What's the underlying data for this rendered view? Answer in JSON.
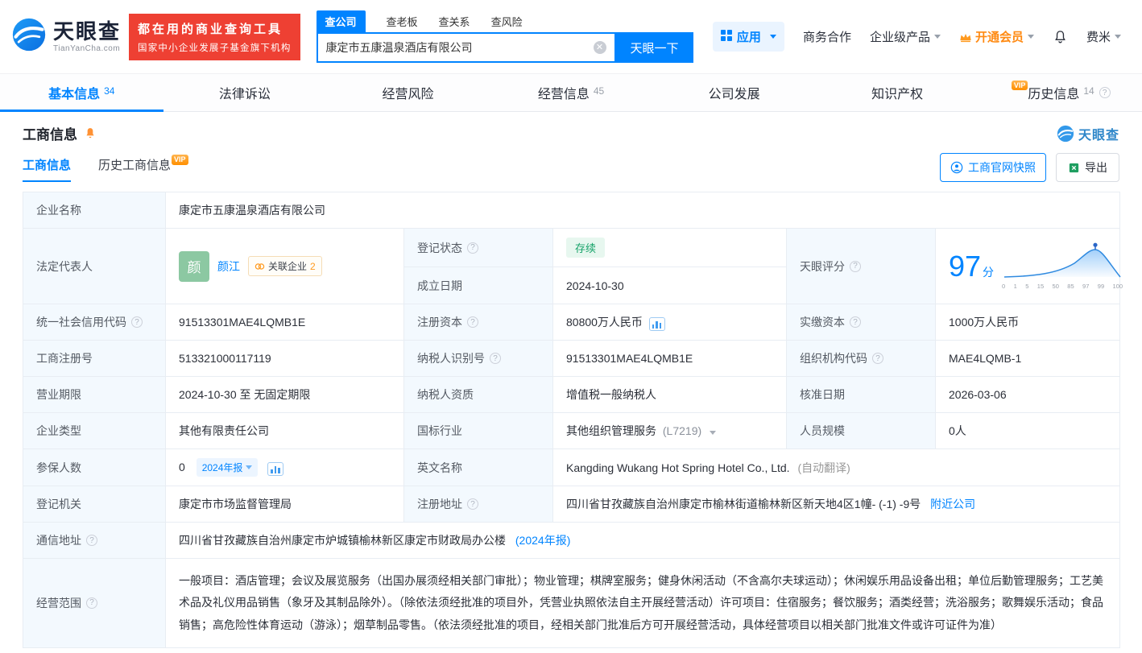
{
  "vip_tag": "VIP",
  "brand": {
    "logo_text": "天眼查",
    "logo_domain": "TianYanCha.com",
    "banner_line1": "都在用的商业查询工具",
    "banner_line2": "国家中小企业发展子基金旗下机构"
  },
  "search": {
    "tab_company": "查公司",
    "tab_boss": "查老板",
    "tab_relation": "查关系",
    "tab_risk": "查风险",
    "value": "康定市五康温泉酒店有限公司",
    "button": "天眼一下"
  },
  "topnav": {
    "app": "应用",
    "cooperation": "商务合作",
    "enterprise": "企业级产品",
    "vip": "开通会员",
    "user": "费米"
  },
  "nav_tabs": {
    "t0": {
      "label": "基本信息",
      "count": "34"
    },
    "t1": {
      "label": "法律诉讼"
    },
    "t2": {
      "label": "经营风险"
    },
    "t3": {
      "label": "经营信息",
      "count": "45"
    },
    "t4": {
      "label": "公司发展"
    },
    "t5": {
      "label": "知识产权"
    },
    "t6": {
      "label": "历史信息",
      "count": "14"
    }
  },
  "section": {
    "title": "工商信息",
    "subtab_current": "工商信息",
    "subtab_history": "历史工商信息",
    "snapshot_button": "工商官网快照",
    "export_button": "导出",
    "watermark": "天眼查"
  },
  "fields": {
    "company_name": {
      "label": "企业名称",
      "value": "康定市五康温泉酒店有限公司"
    },
    "legal_rep": {
      "label": "法定代表人",
      "avatar": "颜",
      "name": "颜江",
      "related_label": "关联企业",
      "related_count": "2"
    },
    "reg_status": {
      "label": "登记状态",
      "value": "存续"
    },
    "establish_date": {
      "label": "成立日期",
      "value": "2024-10-30"
    },
    "score": {
      "label": "天眼评分",
      "value": "97",
      "unit": "分",
      "ticks": [
        "0",
        "1",
        "5",
        "15",
        "50",
        "85",
        "97",
        "99",
        "100"
      ]
    },
    "credit_code": {
      "label": "统一社会信用代码",
      "value": "91513301MAE4LQMB1E"
    },
    "reg_capital": {
      "label": "注册资本",
      "value": "80800万人民币"
    },
    "paid_capital": {
      "label": "实缴资本",
      "value": "1000万人民币"
    },
    "reg_number": {
      "label": "工商注册号",
      "value": "513321000117119"
    },
    "taxpayer_id": {
      "label": "纳税人识别号",
      "value": "91513301MAE4LQMB1E"
    },
    "org_code": {
      "label": "组织机构代码",
      "value": "MAE4LQMB-1"
    },
    "business_term": {
      "label": "营业期限",
      "value": "2024-10-30 至 无固定期限"
    },
    "taxpayer_quality": {
      "label": "纳税人资质",
      "value": "增值税一般纳税人"
    },
    "approval_date": {
      "label": "核准日期",
      "value": "2026-03-06"
    },
    "company_type": {
      "label": "企业类型",
      "value": "其他有限责任公司"
    },
    "industry": {
      "label": "国标行业",
      "value": "其他组织管理服务",
      "code": "(L7219)"
    },
    "staff_size": {
      "label": "人员规模",
      "value": "0人"
    },
    "insured_count": {
      "label": "参保人数",
      "value": "0",
      "badge": "2024年报"
    },
    "english_name": {
      "label": "英文名称",
      "value": "Kangding Wukang Hot Spring Hotel Co., Ltd.",
      "note": "(自动翻译)"
    },
    "reg_authority": {
      "label": "登记机关",
      "value": "康定市市场监督管理局"
    },
    "reg_address": {
      "label": "注册地址",
      "value": "四川省甘孜藏族自治州康定市榆林街道榆林新区新天地4区1幢- (-1) -9号",
      "link": "附近公司"
    },
    "mail_address": {
      "label": "通信地址",
      "value": "四川省甘孜藏族自治州康定市炉城镇榆林新区康定市财政局办公楼",
      "link": "(2024年报)"
    },
    "business_scope": {
      "label": "经营范围",
      "value": "一般项目：酒店管理；会议及展览服务（出国办展须经相关部门审批）；物业管理；棋牌室服务；健身休闲活动（不含高尔夫球运动）；休闲娱乐用品设备出租；单位后勤管理服务；工艺美术品及礼仪用品销售（象牙及其制品除外）。（除依法须经批准的项目外，凭营业执照依法自主开展经营活动）许可项目：住宿服务；餐饮服务；酒类经营；洗浴服务；歌舞娱乐活动；食品销售；高危险性体育运动（游泳）；烟草制品零售。（依法须经批准的项目，经相关部门批准后方可开展经营活动，具体经营项目以相关部门批准文件或许可证件为准）"
    }
  }
}
